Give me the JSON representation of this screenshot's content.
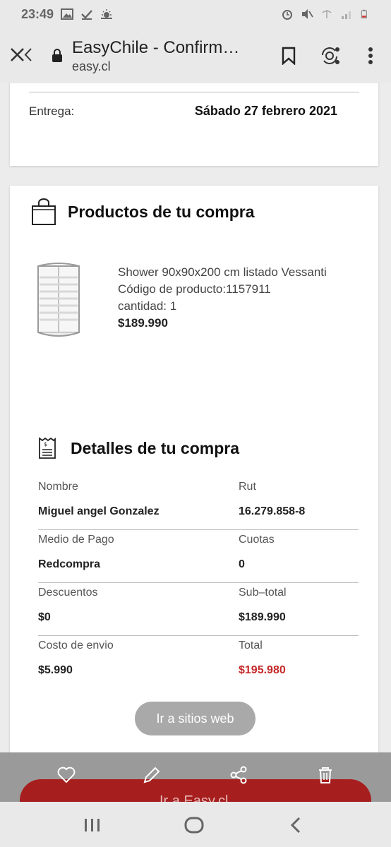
{
  "status_bar": {
    "time": "23:49"
  },
  "browser": {
    "title": "EasyChile - Confirmac...",
    "url": "easy.cl"
  },
  "delivery": {
    "label": "Entrega:",
    "value": "Sábado 27 febrero 2021"
  },
  "products": {
    "heading": "Productos de tu compra",
    "item": {
      "name": "Shower 90x90x200 cm listado Vessanti",
      "code": "Código de producto:1157911",
      "quantity": "cantidad: 1",
      "price": "$189.990"
    }
  },
  "details": {
    "heading": "Detalles de tu compra",
    "rows": [
      {
        "l1": "Nombre",
        "v1": "Miguel angel Gonzalez",
        "l2": "Rut",
        "v2": "16.279.858-8"
      },
      {
        "l1": "Medio de Pago",
        "v1": "Redcompra",
        "l2": "Cuotas",
        "v2": "0"
      },
      {
        "l1": "Descuentos",
        "v1": "$0",
        "l2": "Sub–total",
        "v2": "$189.990"
      },
      {
        "l1": "Costo de envio",
        "v1": "$5.990",
        "l2": "Total",
        "v2": "$195.980"
      }
    ]
  },
  "web_button": "Ir a sitios web",
  "partial_red_button": "Ir a Easy.cl",
  "colors": {
    "accent_red": "#c62828",
    "button_red": "#a71e1e"
  }
}
